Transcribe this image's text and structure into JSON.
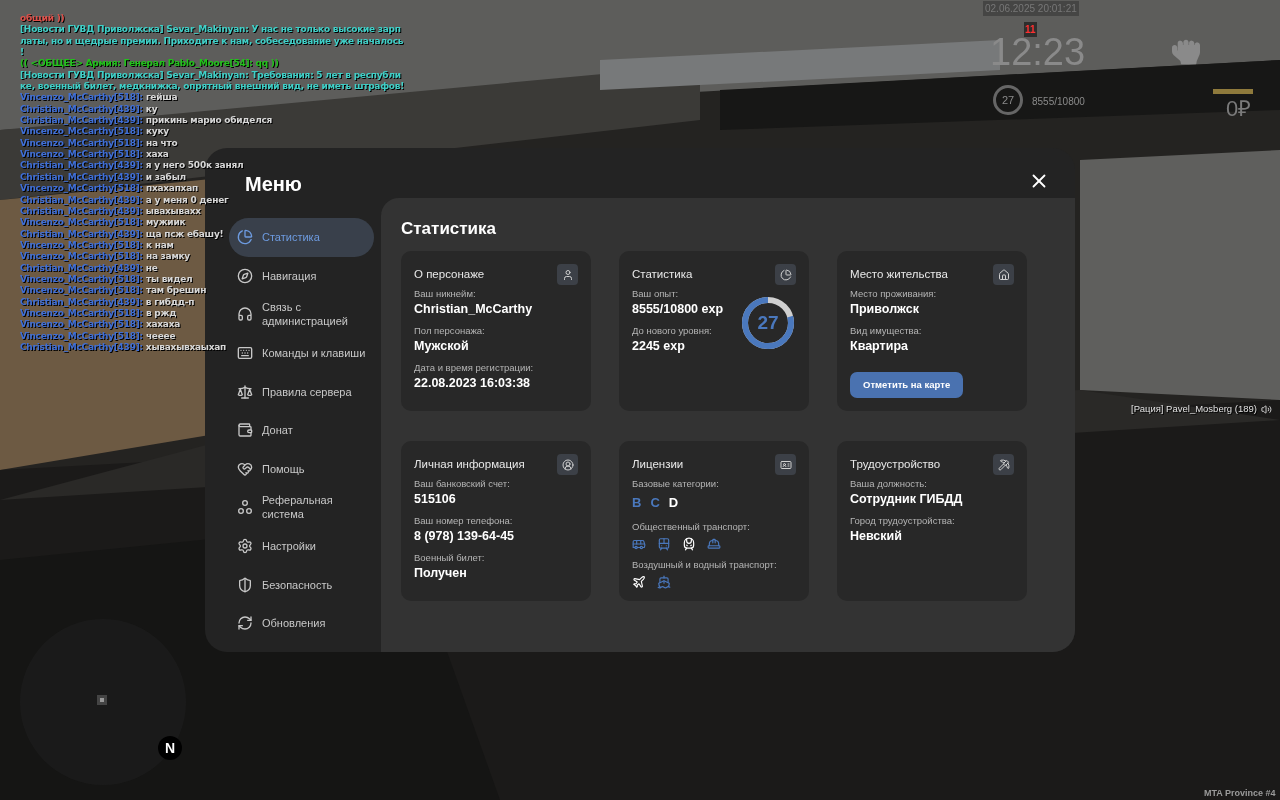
{
  "chat": [
    {
      "kind": "notice",
      "color": "#e0504a",
      "text": "общий ))"
    },
    {
      "kind": "notice",
      "color": "#3fd0c8",
      "text": "[Новости ГУВД Приволжска] Sevar_Makinyan: У нас не только высокие зарп"
    },
    {
      "kind": "notice",
      "color": "#3fd0c8",
      "text": "латы, но и щедрые премии. Приходите к нам, собеседование уже началось\n!"
    },
    {
      "kind": "notice",
      "color": "#21c21a",
      "text": "(( <ОБЩЕЕ> Армия: Генерал Pablo_Moore[54]: qq ))"
    },
    {
      "kind": "notice",
      "color": "#3fd0c8",
      "text": "[Новости ГУВД Приволжска] Sevar_Makinyan: Требования: 5 лет в республи"
    },
    {
      "kind": "notice",
      "color": "#3fd0c8",
      "text": "ке, военный билет, медкнижка, опрятный внешний вид, не иметь штрафов!"
    },
    {
      "kind": "message",
      "author": "Vincenzo_McCarthy[518]:",
      "text": "гейша"
    },
    {
      "kind": "message",
      "author": "Christian_McCarthy[439]:",
      "text": "ку"
    },
    {
      "kind": "message",
      "author": "Christian_McCarthy[439]:",
      "text": "прикинь марио обиделся"
    },
    {
      "kind": "message",
      "author": "Vincenzo_McCarthy[518]:",
      "text": "куку"
    },
    {
      "kind": "message",
      "author": "Vincenzo_McCarthy[518]:",
      "text": "на что"
    },
    {
      "kind": "message",
      "author": "Vincenzo_McCarthy[518]:",
      "text": "хаха"
    },
    {
      "kind": "message",
      "author": "Christian_McCarthy[439]:",
      "text": "я у него 500к занял"
    },
    {
      "kind": "message",
      "author": "Christian_McCarthy[439]:",
      "text": "и забыл"
    },
    {
      "kind": "message",
      "author": "Vincenzo_McCarthy[518]:",
      "text": "пхахапхап"
    },
    {
      "kind": "message",
      "author": "Christian_McCarthy[439]:",
      "text": "а у меня 0 денег"
    },
    {
      "kind": "message",
      "author": "Christian_McCarthy[439]:",
      "text": "ывахывахх"
    },
    {
      "kind": "message",
      "author": "Vincenzo_McCarthy[518]:",
      "text": "мужиик"
    },
    {
      "kind": "message",
      "author": "Christian_McCarthy[439]:",
      "text": "ща псж ебашу!"
    },
    {
      "kind": "message",
      "author": "Vincenzo_McCarthy[518]:",
      "text": "к нам"
    },
    {
      "kind": "message",
      "author": "Vincenzo_McCarthy[518]:",
      "text": "на замку"
    },
    {
      "kind": "message",
      "author": "Christian_McCarthy[439]:",
      "text": "не"
    },
    {
      "kind": "message",
      "author": "Vincenzo_McCarthy[518]:",
      "text": "ты видел"
    },
    {
      "kind": "message",
      "author": "Vincenzo_McCarthy[518]:",
      "text": "там брешин"
    },
    {
      "kind": "message",
      "author": "Christian_McCarthy[439]:",
      "text": "в гибдд-п"
    },
    {
      "kind": "message",
      "author": "Vincenzo_McCarthy[518]:",
      "text": "в ржд"
    },
    {
      "kind": "message",
      "author": "Vincenzo_McCarthy[518]:",
      "text": "хахаха"
    },
    {
      "kind": "message",
      "author": "Vincenzo_McCarthy[518]:",
      "text": "чееее"
    },
    {
      "kind": "message",
      "author": "Christian_McCarthy[439]:",
      "text": "хывахывхаыхап"
    }
  ],
  "hud": {
    "datetime": "02.06.2025 20:01:21",
    "alert": "11",
    "clock": "12:23",
    "level": "27",
    "experience": "8555/10800",
    "money": "0₽"
  },
  "voice": {
    "text": "[Рация] Pavel_Mosberg (189)"
  },
  "server": "MTA Province #4",
  "minimap": {
    "north": "N"
  },
  "menu": {
    "title": "Меню",
    "sidebar": [
      {
        "label": "Статистика",
        "selected": true
      },
      {
        "label": "Навигация",
        "selected": false
      },
      {
        "label": "Связь с администрацией",
        "selected": false
      },
      {
        "label": "Команды и клавиши",
        "selected": false
      },
      {
        "label": "Правила сервера",
        "selected": false
      },
      {
        "label": "Донат",
        "selected": false
      },
      {
        "label": "Помощь",
        "selected": false
      },
      {
        "label": "Реферальная система",
        "selected": false
      },
      {
        "label": "Настройки",
        "selected": false
      },
      {
        "label": "Безопасность",
        "selected": false
      },
      {
        "label": "Обновления",
        "selected": false
      }
    ],
    "heading": "Статистика",
    "cards": [
      {
        "kind": "fields",
        "title": "О персонаже",
        "fields": [
          {
            "label": "Ваш никнейм:",
            "value": "Christian_McCarthy"
          },
          {
            "label": "Пол персонажа:",
            "value": "Мужской"
          },
          {
            "label": "Дата и время регистрации:",
            "value": "22.08.2023 16:03:38"
          }
        ]
      },
      {
        "kind": "progress",
        "title": "Статистика",
        "fields": [
          {
            "label": "Ваш опыт:",
            "value": "8555/10800 exp"
          },
          {
            "label": "До нового уровня:",
            "value": "2245 exp"
          }
        ],
        "ring": {
          "value": "27",
          "level": 0.79
        }
      },
      {
        "kind": "fields",
        "title": "Место жительства",
        "fields": [
          {
            "label": "Место проживания:",
            "value": "Приволжск"
          },
          {
            "label": "Вид имущества:",
            "value": "Квартира"
          }
        ],
        "button": "Отметить на карте"
      },
      {
        "kind": "fields",
        "title": "Личная информация",
        "fields": [
          {
            "label": "Ваш банковский счет:",
            "value": "515106"
          },
          {
            "label": "Ваш номер телефона:",
            "value": "8 (978) 139-64-45"
          },
          {
            "label": "Военный билет:",
            "value": "Получен"
          }
        ]
      },
      {
        "kind": "licenses",
        "title": "Лицензии",
        "categories_label": "Базовые категории:",
        "categories": [
          {
            "label": "B",
            "active": true
          },
          {
            "label": "C",
            "active": true
          },
          {
            "label": "D",
            "active": false
          }
        ],
        "groups": [
          {
            "label": "Общественный транспорт:",
            "items": [
              {
                "kind": "bus",
                "active": true
              },
              {
                "kind": "tram",
                "active": true
              },
              {
                "kind": "train",
                "active": false
              },
              {
                "kind": "cap",
                "active": true
              }
            ]
          },
          {
            "label": "Воздушный и водный транспорт:",
            "items": [
              {
                "kind": "plane",
                "active": false
              },
              {
                "kind": "ship",
                "active": true
              }
            ]
          }
        ]
      },
      {
        "kind": "fields",
        "title": "Трудоустройство",
        "fields": [
          {
            "label": "Ваша должность:",
            "value": "Сотрудник ГИБДД"
          },
          {
            "label": "Город трудоустройства:",
            "value": "Невский"
          }
        ]
      }
    ]
  }
}
